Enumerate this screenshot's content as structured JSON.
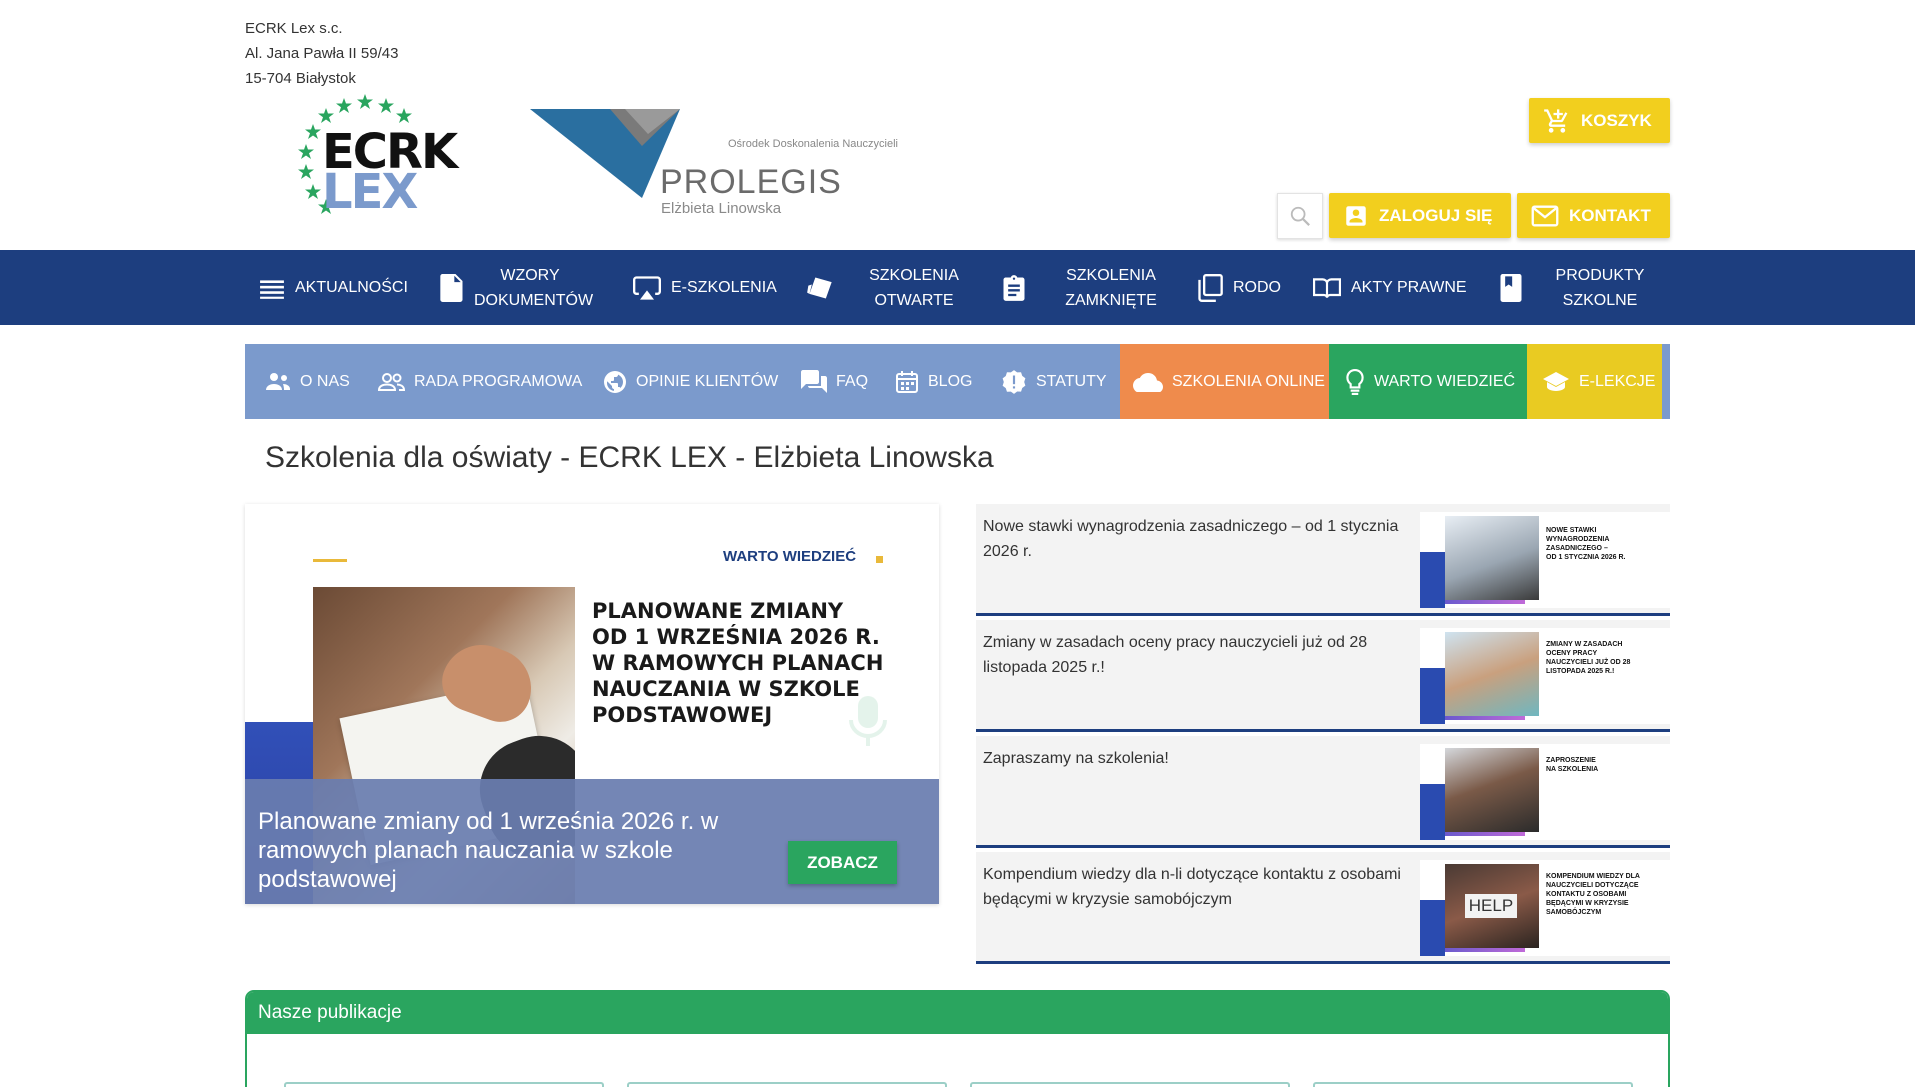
{
  "company": {
    "name": "ECRK Lex s.c.",
    "street": "Al. Jana Pawła II 59/43",
    "city": "15-704 Białystok"
  },
  "logos": {
    "ecrk_line1": "ECRK",
    "ecrk_line2": "LEX",
    "prolegis_tagline": "Ośrodek Doskonalenia Nauczycieli",
    "prolegis_name": "PROLEGIS",
    "prolegis_person": "Elżbieta Linowska"
  },
  "header": {
    "cart": "KOSZYK",
    "login": "ZALOGUJ SIĘ",
    "contact": "KONTAKT"
  },
  "main_nav": [
    {
      "label": "AKTUALNOŚCI",
      "icon": "list-icon"
    },
    {
      "label": "WZORY DOKUMENTÓW",
      "icon": "document-icon"
    },
    {
      "label": "E-SZKOLENIA",
      "icon": "airplay-icon"
    },
    {
      "label": "SZKOLENIA OTWARTE",
      "icon": "layers-icon"
    },
    {
      "label": "SZKOLENIA ZAMKNIĘTE",
      "icon": "clipboard-icon"
    },
    {
      "label": "RODO",
      "icon": "copy-icon"
    },
    {
      "label": "AKTY PRAWNE",
      "icon": "book-open-icon"
    },
    {
      "label": "PRODUKTY SZKOLNE",
      "icon": "book-icon"
    }
  ],
  "sub_nav": [
    {
      "label": "O NAS",
      "icon": "people-icon"
    },
    {
      "label": "RADA PROGRAMOWA",
      "icon": "group-icon"
    },
    {
      "label": "OPINIE KLIENTÓW",
      "icon": "globe-icon"
    },
    {
      "label": "FAQ",
      "icon": "chat-icon"
    },
    {
      "label": "BLOG",
      "icon": "calendar-icon"
    },
    {
      "label": "STATUTY",
      "icon": "badge-icon"
    },
    {
      "label": "SZKOLENIA ONLINE",
      "icon": "cloud-icon"
    },
    {
      "label": "WARTO WIEDZIEĆ",
      "icon": "bulb-icon"
    },
    {
      "label": "E-LEKCJE",
      "icon": "school-icon"
    }
  ],
  "colors": {
    "nav_blue": "#1d3e7f",
    "subnav_blue": "#7b9acc",
    "orange": "#ef8b4c",
    "green": "#2aa55f",
    "yellow": "#f2cf1e"
  },
  "page_title": "Szkolenia dla oświaty - ECRK LEX - Elżbieta Linowska",
  "hero": {
    "badge": "WARTO WIEDZIEĆ",
    "image_heading": [
      "PLANOWANE ZMIANY",
      "OD 1 WRZEŚNIA 2026 R.",
      "W RAMOWYCH PLANACH",
      "NAUCZANIA W SZKOLE",
      "PODSTAWOWEJ"
    ],
    "caption": "Planowane zmiany od 1 września 2026 r. w ramowych planach nauczania w szkole podstawowej",
    "button": "ZOBACZ"
  },
  "news": [
    {
      "text": "Nowe stawki wynagrodzenia zasadniczego – od 1 stycznia 2026 r.",
      "thumb": [
        "NOWE STAWKI",
        "WYNAGRODZENIA",
        "ZASADNICZEGO –",
        "OD 1 STYCZNIA 2026 R."
      ]
    },
    {
      "text": "Zmiany w zasadach oceny pracy nauczycieli już od 28 listopada 2025 r.!",
      "thumb": [
        "ZMIANY W ZASADACH",
        "OCENY PRACY",
        "NAUCZYCIELI JUŻ OD 28",
        "LISTOPADA 2025 R.!"
      ]
    },
    {
      "text": "Zapraszamy na szkolenia!",
      "thumb": [
        "ZAPROSZENIE",
        "NA SZKOLENIA"
      ]
    },
    {
      "text": "Kompendium wiedzy dla n-li dotyczące kontaktu z osobami będącymi w kryzysie samobójczym",
      "thumb": [
        "KOMPENDIUM WIEDZY DLA",
        "NAUCZYCIELI DOTYCZĄCE",
        "KONTAKTU Z OSOBAMI",
        "BĘDĄCYMI W KRYZYSIE",
        "SAMOBÓJCZYM"
      ],
      "photo_text": "HELP"
    }
  ],
  "publications": {
    "heading": "Nasze publikacje"
  }
}
